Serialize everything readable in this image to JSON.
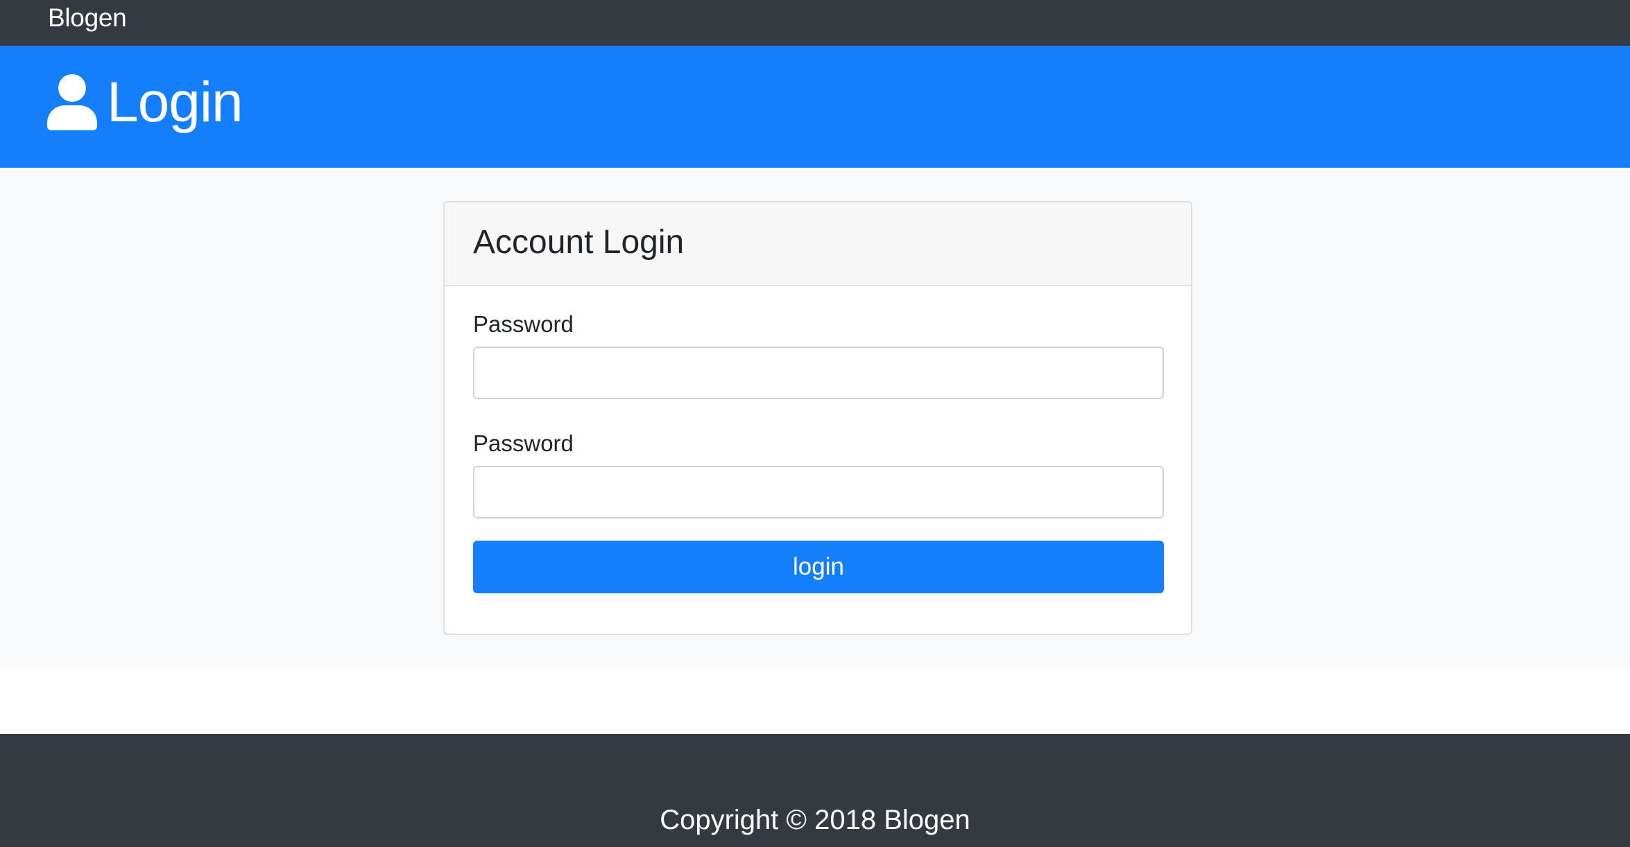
{
  "navbar": {
    "brand": "Blogen"
  },
  "header": {
    "icon": "user-icon",
    "title": "Login"
  },
  "login_card": {
    "title": "Account Login",
    "fields": [
      {
        "label": "Password",
        "value": "",
        "placeholder": ""
      },
      {
        "label": "Password",
        "value": "",
        "placeholder": ""
      }
    ],
    "submit_label": "login"
  },
  "footer": {
    "copyright": "Copyright © 2018 Blogen"
  },
  "colors": {
    "navbar_bg": "#343a40",
    "header_bg": "#157ffb",
    "main_bg": "#f8f9fa",
    "card_header_bg": "#f7f7f7",
    "button_bg": "#157ffb",
    "footer_bg": "#343a40"
  }
}
